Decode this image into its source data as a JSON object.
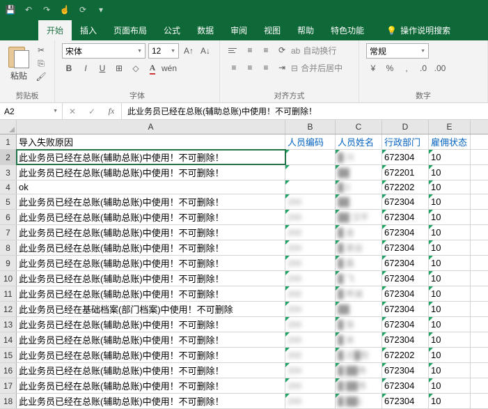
{
  "qat": [
    "save",
    "undo",
    "redo",
    "touch",
    "refresh",
    "more"
  ],
  "tabs": [
    "开始",
    "插入",
    "页面布局",
    "公式",
    "数据",
    "审阅",
    "视图",
    "帮助",
    "特色功能"
  ],
  "tellMe": "操作说明搜索",
  "clipboard": {
    "paste": "粘贴",
    "label": "剪贴板"
  },
  "font": {
    "name": "宋体",
    "size": "12",
    "label": "字体"
  },
  "align": {
    "wrap": "自动换行",
    "merge": "合并后居中",
    "label": "对齐方式"
  },
  "number": {
    "format": "常规",
    "label": "数字"
  },
  "nameBox": "A2",
  "formula": "此业务员已经在总账(辅助总账)中使用！不可删除！",
  "cols": [
    "A",
    "B",
    "C",
    "D",
    "E"
  ],
  "header": {
    "A": "导入失败原因",
    "B": "人员编码",
    "C": "人员姓名",
    "D": "行政部门",
    "E": "雇佣状态"
  },
  "msg1": "此业务员已经在总账(辅助总账)中使用！不可删除！",
  "msg2": "此业务员已经在总账(辅助总账)中使用！不可删除！",
  "msg3": "此业务员已经在基础档案(部门档案)中使用！不可删除",
  "rows": [
    {
      "n": 2,
      "sel": true,
      "A": "@msg1",
      "B": "",
      "C": "█ 兴",
      "D": "672304",
      "E": "10"
    },
    {
      "n": 3,
      "A": "@msg2",
      "B": "",
      "C": "██",
      "D": "672201",
      "E": "10"
    },
    {
      "n": 4,
      "A": "ok",
      "B": "",
      "C": "█彡",
      "D": "672202",
      "E": "10"
    },
    {
      "n": 5,
      "A": "@msg1",
      "B": "200",
      "C": "██",
      "D": "672304",
      "E": "10"
    },
    {
      "n": 6,
      "A": "@msg1",
      "B": "200",
      "C": "██ 汉平",
      "D": "672304",
      "E": "10"
    },
    {
      "n": 7,
      "A": "@msg1",
      "B": "200",
      "C": "█ 金",
      "D": "672304",
      "E": "10"
    },
    {
      "n": 8,
      "A": "@msg1",
      "B": "200",
      "C": "█ 甚运",
      "D": "672304",
      "E": "10"
    },
    {
      "n": 9,
      "A": "@msg1",
      "B": "200",
      "C": "█ 磊",
      "D": "672304",
      "E": "10"
    },
    {
      "n": 10,
      "A": "@msg1",
      "B": "200",
      "C": "█ 飞",
      "D": "672304",
      "E": "10"
    },
    {
      "n": 11,
      "A": "@msg1",
      "B": "200",
      "C": "█ 咚诚",
      "D": "672304",
      "E": "10"
    },
    {
      "n": 12,
      "A": "@msg3",
      "B": "200",
      "C": "██",
      "D": "672304",
      "E": "10"
    },
    {
      "n": 13,
      "A": "@msg1",
      "B": "200",
      "C": "█ 张",
      "D": "672304",
      "E": "10"
    },
    {
      "n": 14,
      "A": "@msg1",
      "B": "200",
      "C": "█ 米",
      "D": "672304",
      "E": "10"
    },
    {
      "n": 15,
      "A": "@msg1",
      "B": "200",
      "C": "█ 近█阳",
      "D": "672202",
      "E": "10"
    },
    {
      "n": 16,
      "A": "@msg1",
      "B": "200",
      "C": "█ ██伟",
      "D": "672304",
      "E": "10"
    },
    {
      "n": 17,
      "A": "@msg1",
      "B": "200",
      "C": "█ ██伟",
      "D": "672304",
      "E": "10"
    },
    {
      "n": 18,
      "A": "@msg1",
      "B": "200",
      "C": "█ ██1",
      "D": "672304",
      "E": "10"
    }
  ]
}
